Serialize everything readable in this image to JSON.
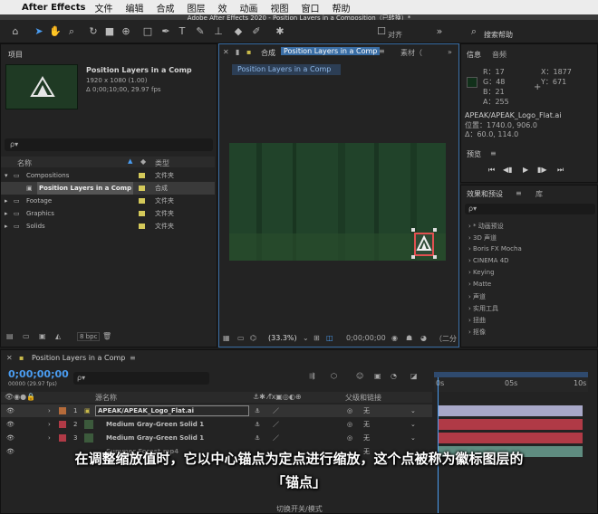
{
  "menubar": {
    "app_name": "After Effects",
    "items": [
      "文件",
      "编辑",
      "合成",
      "图层",
      "效",
      "动画",
      "视图",
      "窗口",
      "帮助"
    ],
    "window_title": "Adobe After Effects 2020 - Position Layers in a Composition（已转换）*"
  },
  "toolbar": {
    "align_label": "对齐",
    "search_label": "搜索帮助"
  },
  "project": {
    "title": "项目",
    "comp_name": "Position Layers in a Comp",
    "comp_res": "1920 x 1080 (1.00)",
    "comp_dur": "Δ 0;00;10;00, 29.97 fps",
    "search_placeholder": "ρ▾",
    "col_name": "名称",
    "col_type": "类型",
    "items": [
      {
        "name": "Compositions",
        "type": "文件夹"
      },
      {
        "name": "Position Layers in a Comp",
        "type": "合成"
      },
      {
        "name": "Footage",
        "type": "文件夹"
      },
      {
        "name": "Graphics",
        "type": "文件夹"
      },
      {
        "name": "Solids",
        "type": "文件夹"
      }
    ],
    "bpc": "8 bpc"
  },
  "comp": {
    "tab_label": "合成",
    "tab_name": "Position Layers in a Comp",
    "tab2": "素材（",
    "subtab": "Position Layers in a Comp",
    "zoom": "(33.3%)",
    "timecode": "0;00;00;00",
    "view_label": "（二分"
  },
  "info": {
    "tab_info": "信息",
    "tab_audio": "音频",
    "r": "R：17",
    "g": "G：48",
    "b": "B：21",
    "a": "A：255",
    "x": "X：1877",
    "y": "Y：671",
    "layer_name": "APEAK/APEAK_Logo_Flat.ai",
    "position": "位置：1740.0, 906.0",
    "delta": "Δ：60.0, 114.0",
    "color_swatch": "#11301a"
  },
  "preview": {
    "title": "预览"
  },
  "effects": {
    "tab1": "效果和预设",
    "tab2": "库",
    "search_placeholder": "ρ▾",
    "items": [
      "* 动画预设",
      "3D 声道",
      "Boris FX Mocha",
      "CINEMA 4D",
      "Keying",
      "Matte",
      "声道",
      "实用工具",
      "扭曲",
      "抠像"
    ]
  },
  "timeline": {
    "tab_label": "Position Layers in a Comp",
    "timecode": "0;00;00;00",
    "frame_info": "00000 (29.97 fps)",
    "col_source": "源名称",
    "col_parent": "父级和链接",
    "ruler": [
      "0s",
      "05s",
      "10s"
    ],
    "layers": [
      {
        "num": "1",
        "name": "APEAK/APEAK_Logo_Flat.ai",
        "parent": "无",
        "label_color": "#b56b3a"
      },
      {
        "num": "2",
        "name": "Medium Gray-Green Solid 1",
        "parent": "无",
        "label_color": "#b03a46"
      },
      {
        "num": "3",
        "name": "Medium Gray-Green Solid 1",
        "parent": "无",
        "label_color": "#b03a46"
      },
      {
        "num": "4",
        "name": "Summer Forest.mp4",
        "parent": "无",
        "label_color": "#5f8c80"
      }
    ],
    "footer": "切换开关/模式"
  },
  "caption": {
    "line1": "在调整缩放值时，它以中心锚点为定点进行缩放，这个点被称为徽标图层的",
    "line2": "「锚点」"
  },
  "colors": {
    "accent": "#4a9cf0",
    "panel_bg": "#232323",
    "viewer_bg": "#22452a",
    "layer_bar_logo": "#a8a8c8",
    "layer_bar_solid": "#b03a46"
  }
}
